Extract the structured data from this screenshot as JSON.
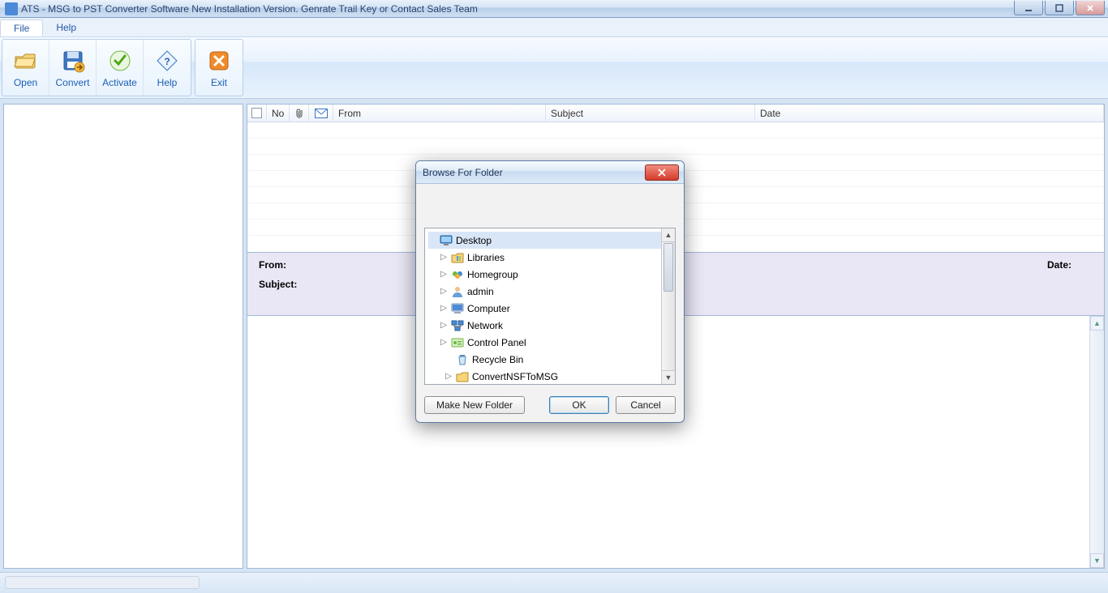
{
  "window": {
    "title": "ATS - MSG to PST Converter Software New Installation Version. Genrate Trail Key or Contact Sales Team"
  },
  "menubar": {
    "file": "File",
    "help": "Help"
  },
  "ribbon": {
    "open": "Open",
    "convert": "Convert",
    "activate": "Activate",
    "help": "Help",
    "exit": "Exit"
  },
  "grid": {
    "headers": {
      "no": "No",
      "from": "From",
      "subject": "Subject",
      "date": "Date"
    }
  },
  "detail": {
    "from_label": "From:",
    "subject_label": "Subject:",
    "date_label": "Date:"
  },
  "dialog": {
    "title": "Browse For Folder",
    "tree": [
      {
        "label": "Desktop",
        "icon": "desktop",
        "expandable": false,
        "selected": true,
        "indent": 0
      },
      {
        "label": "Libraries",
        "icon": "libraries",
        "expandable": true,
        "selected": false,
        "indent": 1
      },
      {
        "label": "Homegroup",
        "icon": "homegroup",
        "expandable": true,
        "selected": false,
        "indent": 1
      },
      {
        "label": "admin",
        "icon": "user",
        "expandable": true,
        "selected": false,
        "indent": 1
      },
      {
        "label": "Computer",
        "icon": "computer",
        "expandable": true,
        "selected": false,
        "indent": 1
      },
      {
        "label": "Network",
        "icon": "network",
        "expandable": true,
        "selected": false,
        "indent": 1
      },
      {
        "label": "Control Panel",
        "icon": "cpanel",
        "expandable": true,
        "selected": false,
        "indent": 1
      },
      {
        "label": "Recycle Bin",
        "icon": "recycle",
        "expandable": false,
        "selected": false,
        "indent": 2
      },
      {
        "label": "ConvertNSFToMSG",
        "icon": "folder",
        "expandable": true,
        "selected": false,
        "indent": 2
      }
    ],
    "buttons": {
      "make_new": "Make New Folder",
      "ok": "OK",
      "cancel": "Cancel"
    }
  }
}
